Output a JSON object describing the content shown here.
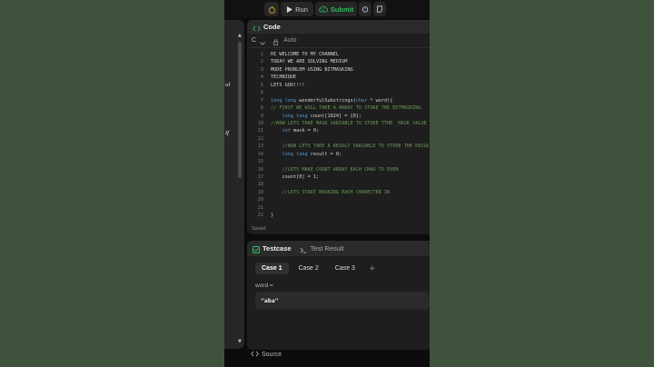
{
  "toolbar": {
    "run_label": "Run",
    "submit_label": "Submit",
    "submit_color": "#2dbd5a"
  },
  "left_panel": {
    "fragments": [
      "of",
      "If"
    ]
  },
  "code_panel": {
    "title": "Code",
    "language": "C",
    "mode": "Auto",
    "status": "Saved",
    "lines": [
      {
        "n": "1",
        "text": "HI WELCOME TO MY CHANNEL",
        "kind": "plain"
      },
      {
        "n": "2",
        "text": "TODAY WE ARE SOLVING MEDIUM",
        "kind": "plain"
      },
      {
        "n": "3",
        "text": "MODE PROBLEM USING BITMASKING",
        "kind": "plain"
      },
      {
        "n": "4",
        "text": "TECHNIQUE",
        "kind": "plain"
      },
      {
        "n": "5",
        "text": "LETS GOO!!!!",
        "kind": "plain"
      },
      {
        "n": "6",
        "text": "",
        "kind": "plain"
      },
      {
        "n": "7",
        "text": "long long wonderfulSubstrings(char * word){",
        "kind": "code"
      },
      {
        "n": "8",
        "text": "// FIRST WE WILL TAKE A ARRAY TO STORE THE BITMASKING",
        "kind": "comment"
      },
      {
        "n": "9",
        "text": "    long long count[1024] = {0};",
        "kind": "code"
      },
      {
        "n": "10",
        "text": "//NOW LETS TAKE MASK VARIABLE TO STORE TTHE  MASK VALUE",
        "kind": "comment"
      },
      {
        "n": "11",
        "text": "    int mask = 0;",
        "kind": "code"
      },
      {
        "n": "12",
        "text": "",
        "kind": "plain"
      },
      {
        "n": "13",
        "text": "    //NOW LETS TAKE A RESULT VARIABLE TO STORE THE RESULT",
        "kind": "comment"
      },
      {
        "n": "14",
        "text": "    long long result = 0;",
        "kind": "code"
      },
      {
        "n": "15",
        "text": "",
        "kind": "plain"
      },
      {
        "n": "16",
        "text": "    //LETS MAKE COUNT ARRAY EACH CHAR TO EVEN",
        "kind": "comment"
      },
      {
        "n": "17",
        "text": "    count[0] = 1;",
        "kind": "code"
      },
      {
        "n": "18",
        "text": "",
        "kind": "plain"
      },
      {
        "n": "19",
        "text": "    //LETS START MASKING EACH CHARECTER IN",
        "kind": "comment"
      },
      {
        "n": "20",
        "text": "",
        "kind": "plain"
      },
      {
        "n": "21",
        "text": "",
        "kind": "plain"
      },
      {
        "n": "22",
        "text": "}",
        "kind": "plain"
      }
    ]
  },
  "test_panel": {
    "tab_testcase": "Testcase",
    "tab_result": "Test Result",
    "cases": [
      "Case 1",
      "Case 2",
      "Case 3"
    ],
    "add_case": "+",
    "var_label": "word =",
    "var_value": "\"aba\""
  },
  "source_label": "Source"
}
